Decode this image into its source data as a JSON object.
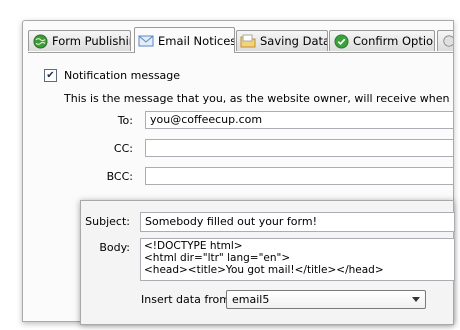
{
  "tabs": [
    {
      "label": "Form Publishing",
      "icon": "globe-icon",
      "active": false
    },
    {
      "label": "Email Notices",
      "icon": "envelope-icon",
      "active": true
    },
    {
      "label": "Saving Data",
      "icon": "folder-icon",
      "active": false
    },
    {
      "label": "Confirm Options",
      "icon": "check-circle-icon",
      "active": false
    }
  ],
  "notification": {
    "checkbox_label": "Notification message",
    "checked": true,
    "description": "This is the message that you, as the website owner, will receive when someone c"
  },
  "fields": {
    "to_label": "To:",
    "to_value": "you@coffeecup.com",
    "cc_label": "CC:",
    "cc_value": "",
    "bcc_label": "BCC:",
    "bcc_value": ""
  },
  "message": {
    "subject_label": "Subject:",
    "subject_value": "Somebody filled out your form!",
    "body_label": "Body:",
    "body_value": "<!DOCTYPE html>\n<html dir=\"ltr\" lang=\"en\">\n<head><title>You got mail!</title></head>",
    "insert_label": "Insert data from:",
    "insert_value": "email5"
  },
  "colors": {
    "globe": "#3f9a3a",
    "envelope": "#5a86c8",
    "folder": "#e8b84a",
    "check": "#3aa23a"
  }
}
